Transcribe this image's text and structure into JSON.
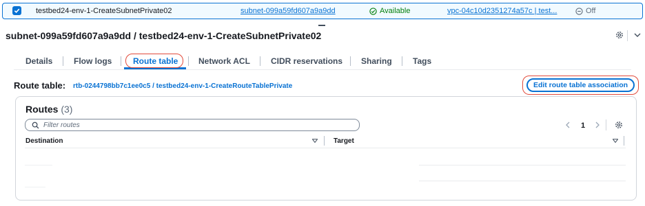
{
  "selected_row": {
    "name": "testbed24-env-1-CreateSubnetPrivate02",
    "subnet_id": "subnet-099a59fd607a9a9dd",
    "state": "Available",
    "vpc": "vpc-04c10d2351274a57c | test...",
    "block_public_access": "Off"
  },
  "detail": {
    "title": "subnet-099a59fd607a9a9dd / testbed24-env-1-CreateSubnetPrivate02"
  },
  "tabs": [
    {
      "label": "Details"
    },
    {
      "label": "Flow logs"
    },
    {
      "label": "Route table",
      "active": true
    },
    {
      "label": "Network ACL"
    },
    {
      "label": "CIDR reservations"
    },
    {
      "label": "Sharing"
    },
    {
      "label": "Tags"
    }
  ],
  "route_table": {
    "label": "Route table:",
    "link": "rtb-0244798bb7c1ee0c5 / testbed24-env-1-CreateRouteTablePrivate",
    "edit_button": "Edit route table association"
  },
  "routes": {
    "title": "Routes",
    "count": "(3)",
    "filter_placeholder": "Filter routes",
    "page": "1",
    "columns": [
      "Destination",
      "Target"
    ]
  },
  "colors": {
    "accent": "#0972d3",
    "success": "#037f0c",
    "annotation": "#e14a3b"
  }
}
